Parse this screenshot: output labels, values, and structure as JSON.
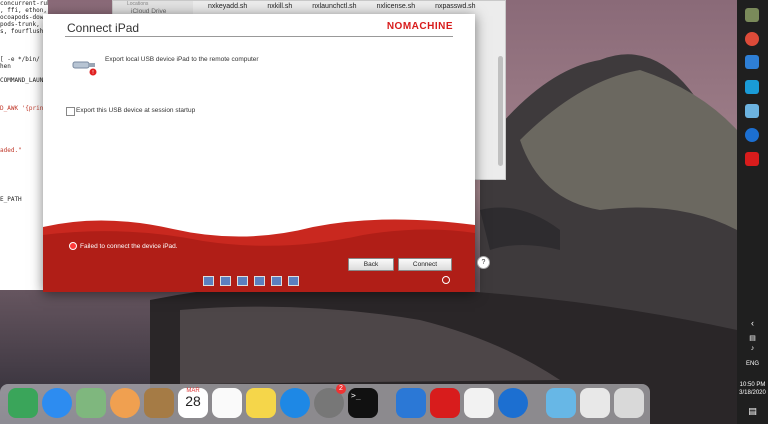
{
  "terminal": {
    "lines": [
      "concurrent-rub",
      ", ffi, ethon,",
      "ocoapods-downl",
      "pods-trunk, co",
      "s, fourflushe",
      "",
      "",
      "",
      "[ -e */bin/",
      "hen",
      "",
      " COMMAND_LAUN",
      "",
      "",
      "",
      "D_AWK '{prin",
      "",
      "",
      "",
      "",
      "",
      "aded.\"",
      "",
      "",
      "",
      "",
      "",
      "",
      "E_PATH"
    ]
  },
  "finder": {
    "sidebar_section": "Locations",
    "sidebar_item": "iCloud Drive",
    "files": [
      "nxkeyadd.sh",
      "nxkill.sh",
      "nxlaunchctl.sh",
      "nxlicense.sh",
      "nxpasswd.sh"
    ]
  },
  "dialog": {
    "title": "Connect iPad",
    "brand": "NOMACHINE",
    "export_line": "Export local USB device iPad to the remote computer",
    "checkbox_label": "Export this USB device at session startup",
    "error": "Failed to connect the device iPad.",
    "back_label": "Back",
    "connect_label": "Connect"
  },
  "help": {
    "label": "?"
  },
  "tray": {
    "lang": "ENG",
    "time": "10:50 PM",
    "date": "3/18/2020"
  },
  "dock": {
    "calendar_month": "MAR",
    "calendar_day": "28",
    "badge": "2",
    "terminal_prompt": ">_"
  },
  "colors": {
    "brand_red": "#d81c1c"
  }
}
